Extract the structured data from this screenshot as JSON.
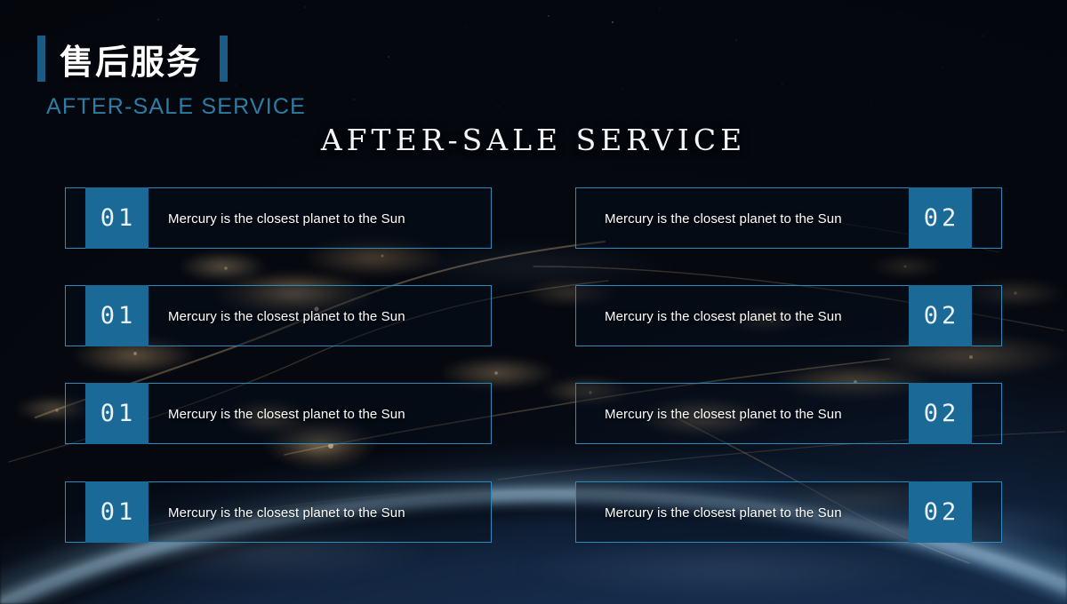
{
  "header": {
    "title_cn": "售后服务",
    "title_en": "AFTER-SALE SERVICE",
    "accent_bar_color": "#1a5c86",
    "subtitle_color": "#2b7da4"
  },
  "headline": {
    "text": "AFTER-SALE  SERVICE"
  },
  "theme": {
    "accent_block_color": "#1a6996",
    "border_color": "#2c8bba",
    "text_color": "#ffffff",
    "background": "earth-at-night-from-space"
  },
  "items": {
    "left": [
      {
        "number": "01",
        "text": "Mercury is the closest planet to the Sun"
      },
      {
        "number": "01",
        "text": "Mercury is the closest planet to the Sun"
      },
      {
        "number": "01",
        "text": "Mercury is the closest planet to the Sun"
      },
      {
        "number": "01",
        "text": "Mercury is the closest planet to the Sun"
      }
    ],
    "right": [
      {
        "number": "02",
        "text": "Mercury is the closest planet to the Sun"
      },
      {
        "number": "02",
        "text": "Mercury is the closest planet to the Sun"
      },
      {
        "number": "02",
        "text": "Mercury is the closest planet to the Sun"
      },
      {
        "number": "02",
        "text": "Mercury is the closest planet to the Sun"
      }
    ]
  }
}
